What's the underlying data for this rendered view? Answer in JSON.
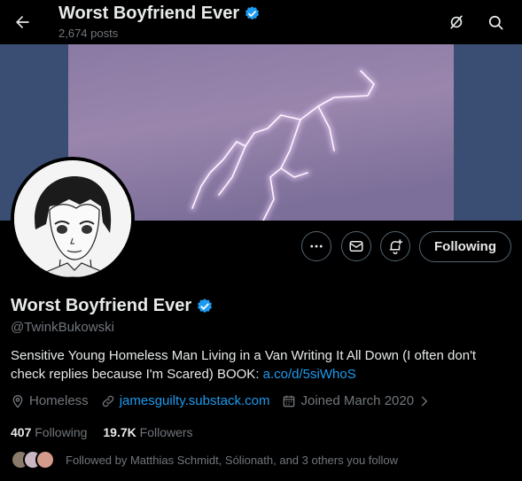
{
  "header": {
    "title": "Worst Boyfriend Ever",
    "posts_count": "2,674 posts"
  },
  "colors": {
    "accent": "#1d9bf0",
    "background": "#000000",
    "muted": "#71767b",
    "banner_sky": "#3a4d72"
  },
  "icons": {
    "back": "back-arrow-icon",
    "grok": "grok-icon",
    "search": "search-icon",
    "verified": "verified-badge-icon",
    "more": "more-icon",
    "message": "mail-icon",
    "notify": "notification-bell-icon",
    "location": "location-pin-icon",
    "link": "link-icon",
    "calendar": "calendar-icon"
  },
  "profile": {
    "display_name": "Worst Boyfriend Ever",
    "handle": "@TwinkBukowski",
    "bio_text": "Sensitive Young Homeless Man Living in a Van Writing It All Down (I often don't check replies because I'm Scared) BOOK: ",
    "bio_link": "a.co/d/5siWhoS",
    "location": "Homeless",
    "website": "jamesguilty.substack.com",
    "joined": "Joined March 2020",
    "following_count": "407",
    "following_label": "Following",
    "followers_count": "19.7K",
    "followers_label": "Followers",
    "followed_by": "Followed by Matthias Schmidt, Sólionath, and 3 others you follow"
  },
  "actions": {
    "follow_label": "Following"
  }
}
